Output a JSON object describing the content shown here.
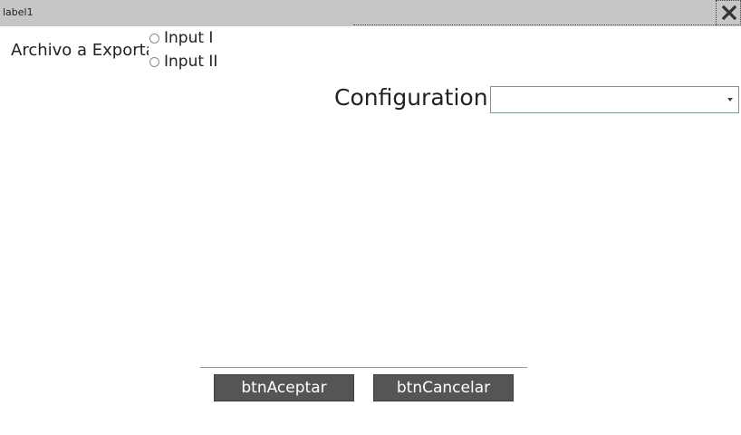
{
  "window": {
    "title": "label1"
  },
  "icons": {
    "close": "close-icon",
    "dropdown": "chevron-down-icon"
  },
  "export": {
    "label": "Archivo a Exportar",
    "options": [
      {
        "label": "Input I",
        "selected": false
      },
      {
        "label": "Input II",
        "selected": false
      }
    ]
  },
  "configuration": {
    "label": "Configuration :",
    "selected_value": ""
  },
  "buttons": {
    "accept_label": "btnAceptar",
    "cancel_label": "btnCancelar"
  },
  "colors": {
    "titlebar_bg": "#c7c5c6",
    "button_bg": "#555555",
    "select_border": "#7a9a85"
  }
}
